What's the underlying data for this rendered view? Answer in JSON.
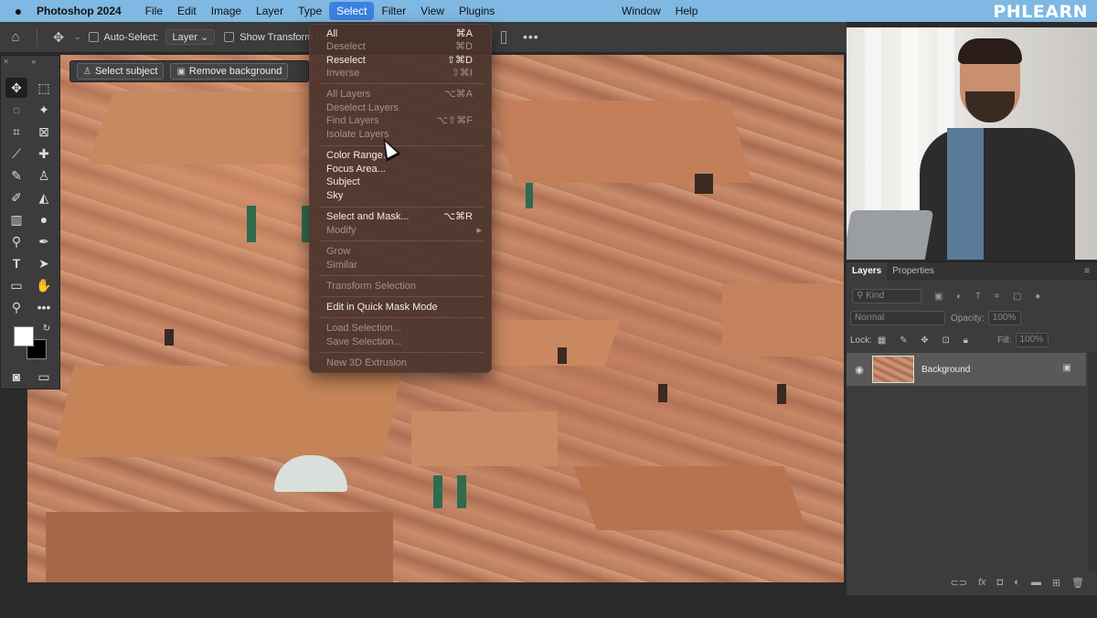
{
  "menubar": {
    "app": "Photoshop 2024",
    "items": [
      "File",
      "Edit",
      "Image",
      "Layer",
      "Type",
      "Select",
      "Filter",
      "View",
      "Plugins"
    ],
    "right_items": [
      "Window",
      "Help"
    ],
    "logo": "PHLEARN"
  },
  "options": {
    "auto_select": "Auto-Select:",
    "layer_dd": "Layer",
    "show_transform": "Show Transform Co"
  },
  "context_bar": {
    "select_subject": "Select subject",
    "remove_background": "Remove background"
  },
  "select_menu": {
    "items": [
      {
        "label": "All",
        "shortcut": "⌘A",
        "disabled": false
      },
      {
        "label": "Deselect",
        "shortcut": "⌘D",
        "disabled": true
      },
      {
        "label": "Reselect",
        "shortcut": "⇧⌘D",
        "disabled": false
      },
      {
        "label": "Inverse",
        "shortcut": "⇧⌘I",
        "disabled": true
      },
      {
        "label": "All Layers",
        "shortcut": "⌥⌘A",
        "disabled": true
      },
      {
        "label": "Deselect Layers",
        "shortcut": "",
        "disabled": true
      },
      {
        "label": "Find Layers",
        "shortcut": "⌥⇧⌘F",
        "disabled": true
      },
      {
        "label": "Isolate Layers",
        "shortcut": "",
        "disabled": true
      },
      {
        "label": "Color Range...",
        "shortcut": "",
        "disabled": false
      },
      {
        "label": "Focus Area...",
        "shortcut": "",
        "disabled": false
      },
      {
        "label": "Subject",
        "shortcut": "",
        "disabled": false
      },
      {
        "label": "Sky",
        "shortcut": "",
        "disabled": false
      },
      {
        "label": "Select and Mask...",
        "shortcut": "⌥⌘R",
        "disabled": false
      },
      {
        "label": "Modify",
        "shortcut": "",
        "disabled": true
      },
      {
        "label": "Grow",
        "shortcut": "",
        "disabled": true
      },
      {
        "label": "Similar",
        "shortcut": "",
        "disabled": true
      },
      {
        "label": "Transform Selection",
        "shortcut": "",
        "disabled": true
      },
      {
        "label": "Edit in Quick Mask Mode",
        "shortcut": "",
        "disabled": false
      },
      {
        "label": "Load Selection...",
        "shortcut": "",
        "disabled": true
      },
      {
        "label": "Save Selection...",
        "shortcut": "",
        "disabled": true
      },
      {
        "label": "New 3D Extrusion",
        "shortcut": "",
        "disabled": true
      }
    ]
  },
  "layers_panel": {
    "tabs": [
      "Layers",
      "Properties"
    ],
    "kind": "Kind",
    "blend_mode": "Normal",
    "opacity_label": "Opacity:",
    "opacity_value": "100%",
    "lock_label": "Lock:",
    "fill_label": "Fill:",
    "fill_value": "100%",
    "layer_name": "Background"
  },
  "icons": {
    "menu_arrow": "▸",
    "apple": "apple-logo-icon"
  }
}
